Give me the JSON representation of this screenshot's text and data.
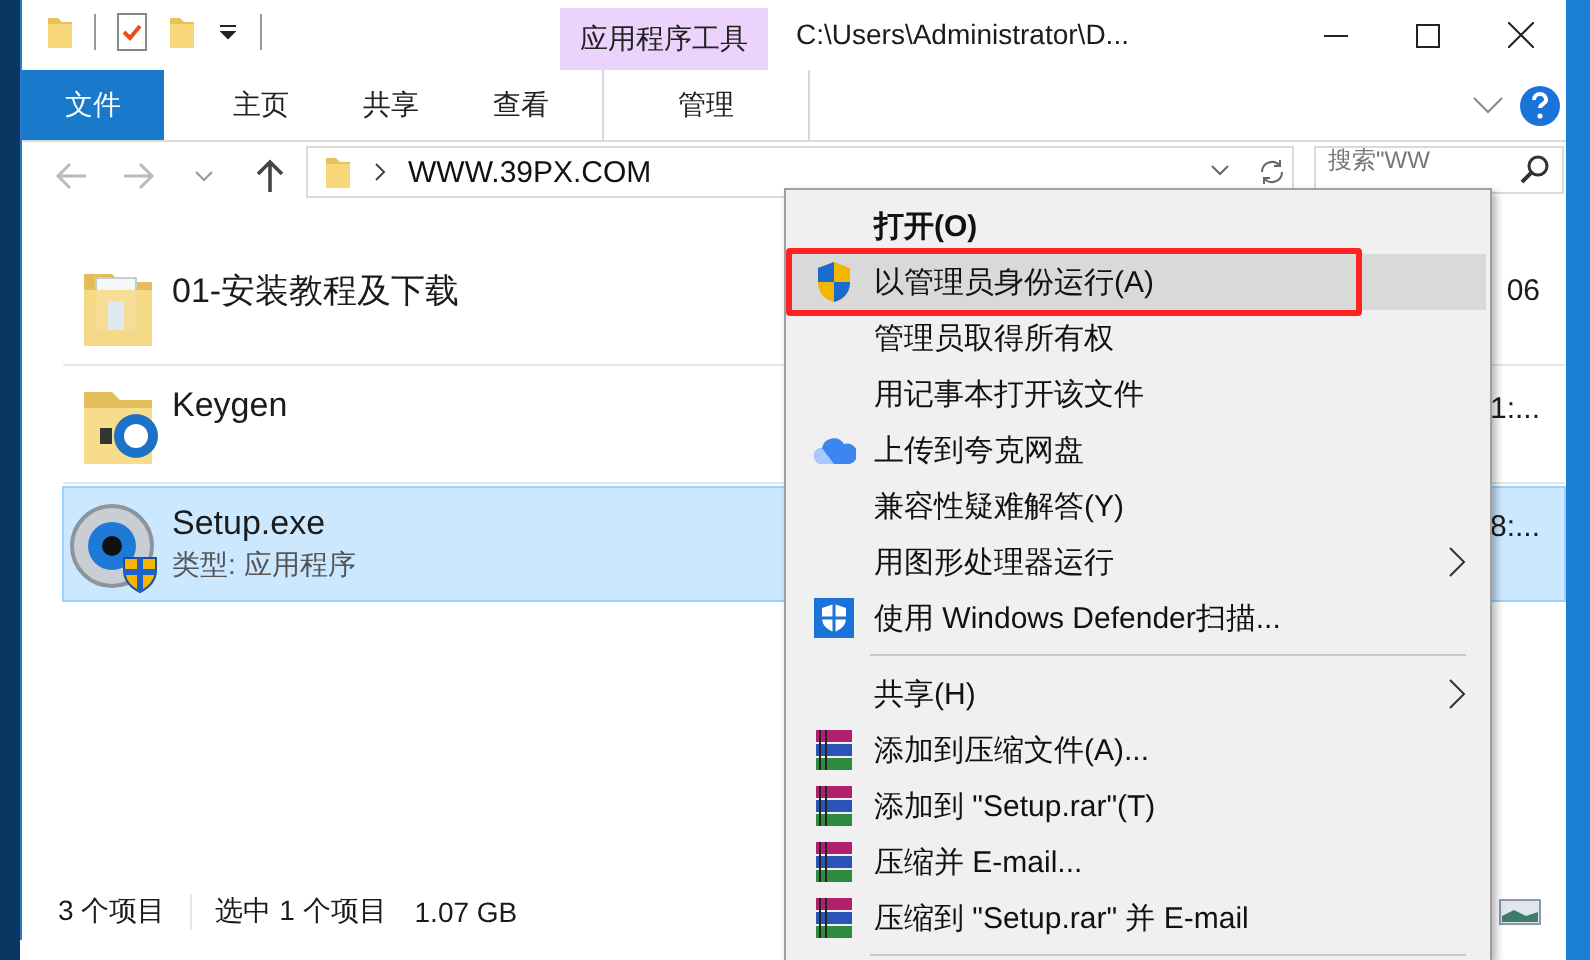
{
  "window": {
    "title": "C:\\Users\\Administrator\\D...",
    "context_group": "应用程序工具"
  },
  "ribbon_tabs": [
    {
      "label": "文件",
      "kind": "file"
    },
    {
      "label": "主页",
      "kind": "tab"
    },
    {
      "label": "共享",
      "kind": "tab"
    },
    {
      "label": "查看",
      "kind": "tab"
    },
    {
      "label": "管理",
      "kind": "context"
    }
  ],
  "address": {
    "path": "WWW.39PX.COM"
  },
  "search": {
    "placeholder": "搜索\"WW"
  },
  "files": [
    {
      "name": "01-安装教程及下载",
      "kind": "folder",
      "column_2": "06",
      "selected": false
    },
    {
      "name": "Keygen",
      "kind": "folder-app",
      "column_2": "1:...",
      "selected": false
    },
    {
      "name": "Setup.exe",
      "kind": "exe",
      "type": "类型: 应用程序",
      "column_2": "8:...",
      "selected": true
    }
  ],
  "status_bar": {
    "count": "3 个项目",
    "selection": "选中 1 个项目",
    "size": "1.07 GB"
  },
  "menu": {
    "items": [
      {
        "kind": "default",
        "label": "打开(O)",
        "submenu": false,
        "selected": false,
        "outlined": false
      },
      {
        "kind": "shield",
        "label": "以管理员身份运行(A)",
        "submenu": false,
        "selected": true,
        "outlined": true
      },
      {
        "kind": "item",
        "label": "管理员取得所有权",
        "submenu": false,
        "selected": false,
        "outlined": false
      },
      {
        "kind": "item",
        "label": "用记事本打开该文件",
        "submenu": false,
        "selected": false,
        "outlined": false
      },
      {
        "kind": "cloud",
        "label": "上传到夸克网盘",
        "submenu": false,
        "selected": false,
        "outlined": false
      },
      {
        "kind": "item",
        "label": "兼容性疑难解答(Y)",
        "submenu": false,
        "selected": false,
        "outlined": false
      },
      {
        "kind": "item",
        "label": "用图形处理器运行",
        "submenu": true,
        "selected": false,
        "outlined": false
      },
      {
        "kind": "defender",
        "label": "使用 Windows Defender扫描...",
        "submenu": false,
        "selected": false,
        "outlined": false
      },
      {
        "kind": "separator"
      },
      {
        "kind": "item",
        "label": "共享(H)",
        "submenu": true,
        "selected": false,
        "outlined": false
      },
      {
        "kind": "archive",
        "label": "添加到压缩文件(A)...",
        "submenu": false,
        "selected": false,
        "outlined": false
      },
      {
        "kind": "archive",
        "label": "添加到 \"Setup.rar\"(T)",
        "submenu": false,
        "selected": false,
        "outlined": false
      },
      {
        "kind": "archive",
        "label": "压缩并 E-mail...",
        "submenu": false,
        "selected": false,
        "outlined": false
      },
      {
        "kind": "archive",
        "label": "压缩到 \"Setup.rar\" 并 E-mail",
        "submenu": false,
        "selected": false,
        "outlined": false
      },
      {
        "kind": "separator"
      }
    ]
  }
}
